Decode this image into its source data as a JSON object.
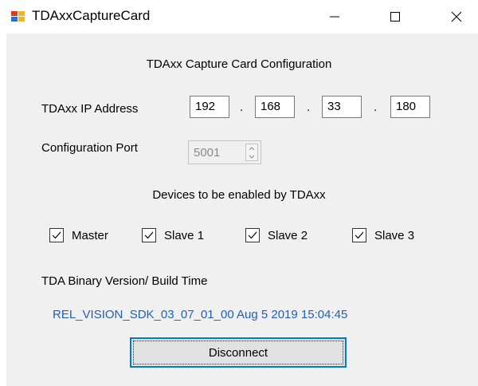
{
  "window": {
    "title": "TDAxxCaptureCard",
    "controls": {
      "minimize": "minimize-icon",
      "maximize": "maximize-icon",
      "close": "close-icon"
    }
  },
  "config": {
    "title": "TDAxx Capture Card Configuration",
    "ip_label": "TDAxx IP Address",
    "ip_octets": [
      "192",
      "168",
      "33",
      "180"
    ],
    "ip_separator": ".",
    "port_label": "Configuration Port",
    "port_value": "5001",
    "devices_label": "Devices to be enabled by TDAxx",
    "devices": [
      {
        "label": "Master",
        "checked": true
      },
      {
        "label": "Slave 1",
        "checked": true
      },
      {
        "label": "Slave 2",
        "checked": true
      },
      {
        "label": "Slave 3",
        "checked": true
      }
    ],
    "binary_label": "TDA Binary Version/ Build Time",
    "binary_version": "REL_VISION_SDK_03_07_01_00 Aug  5 2019 15:04:45",
    "disconnect_label": "Disconnect"
  },
  "colors": {
    "version_text": "#1f5fbf",
    "button_focus": "#0078d7",
    "client_bg": "#f0f0f0"
  }
}
